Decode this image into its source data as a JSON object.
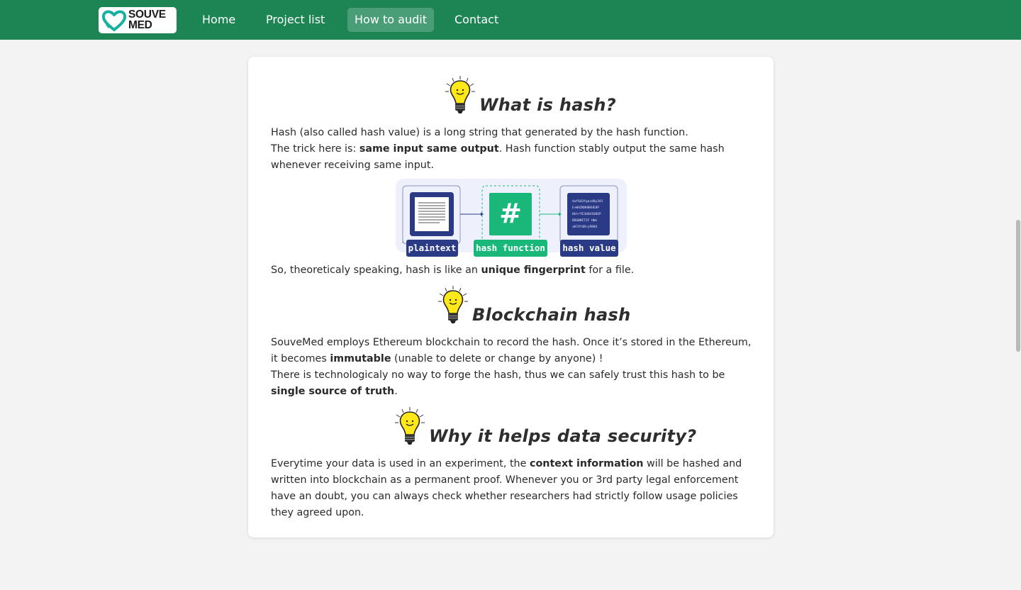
{
  "nav": {
    "logo_line1": "SOUVE",
    "logo_line2": "MED",
    "items": [
      "Home",
      "Project list",
      "How to audit",
      "Contact"
    ],
    "active_index": 2
  },
  "colors": {
    "navbar": "#1d8554",
    "nav_active": "#4a9e77",
    "diagram_navy": "#2b3a84",
    "diagram_green": "#19b87a",
    "bulb_yellow": "#ffe81a"
  },
  "sections": {
    "hash": {
      "title": "What is hash?",
      "p1": "Hash (also called hash value) is a long string that generated by the hash function.",
      "p2_pre": "The trick here is: ",
      "p2_bold": "same input same output",
      "p2_post": ". Hash function stably output the same hash whenever receiving same input.",
      "p3_pre": "So, theoreticaly speaking, hash is like an ",
      "p3_bold": "unique fingerprint",
      "p3_post": " for a file."
    },
    "diagram": {
      "label_plaintext": "plaintext",
      "label_function": "hash function",
      "label_value": "hash value",
      "hash_symbol": "#"
    },
    "blockchain": {
      "title": "Blockchain hash",
      "p1_pre": "SouveMed employs Ethereum blockchain to record the hash. Once it’s stored in the Ethereum, it becomes ",
      "p1_bold": "immutable",
      "p1_post": " (unable to delete or change by anyone) !",
      "p2_pre": "There is technologicaly no way to forge the hash, thus we can safely trust this hash to be ",
      "p2_bold": "single source of truth",
      "p2_post": "."
    },
    "security": {
      "title": "Why it helps data security?",
      "p1_pre": "Everytime your data is used in an experiment, the ",
      "p1_bold": "context information",
      "p1_post": " will be hashed and written into blockchain as a permanent proof. Whenever you or 3rd party legal enforcement have an doubt, you can always check whether researchers had strictly follow usage policies they agreed upon."
    }
  }
}
